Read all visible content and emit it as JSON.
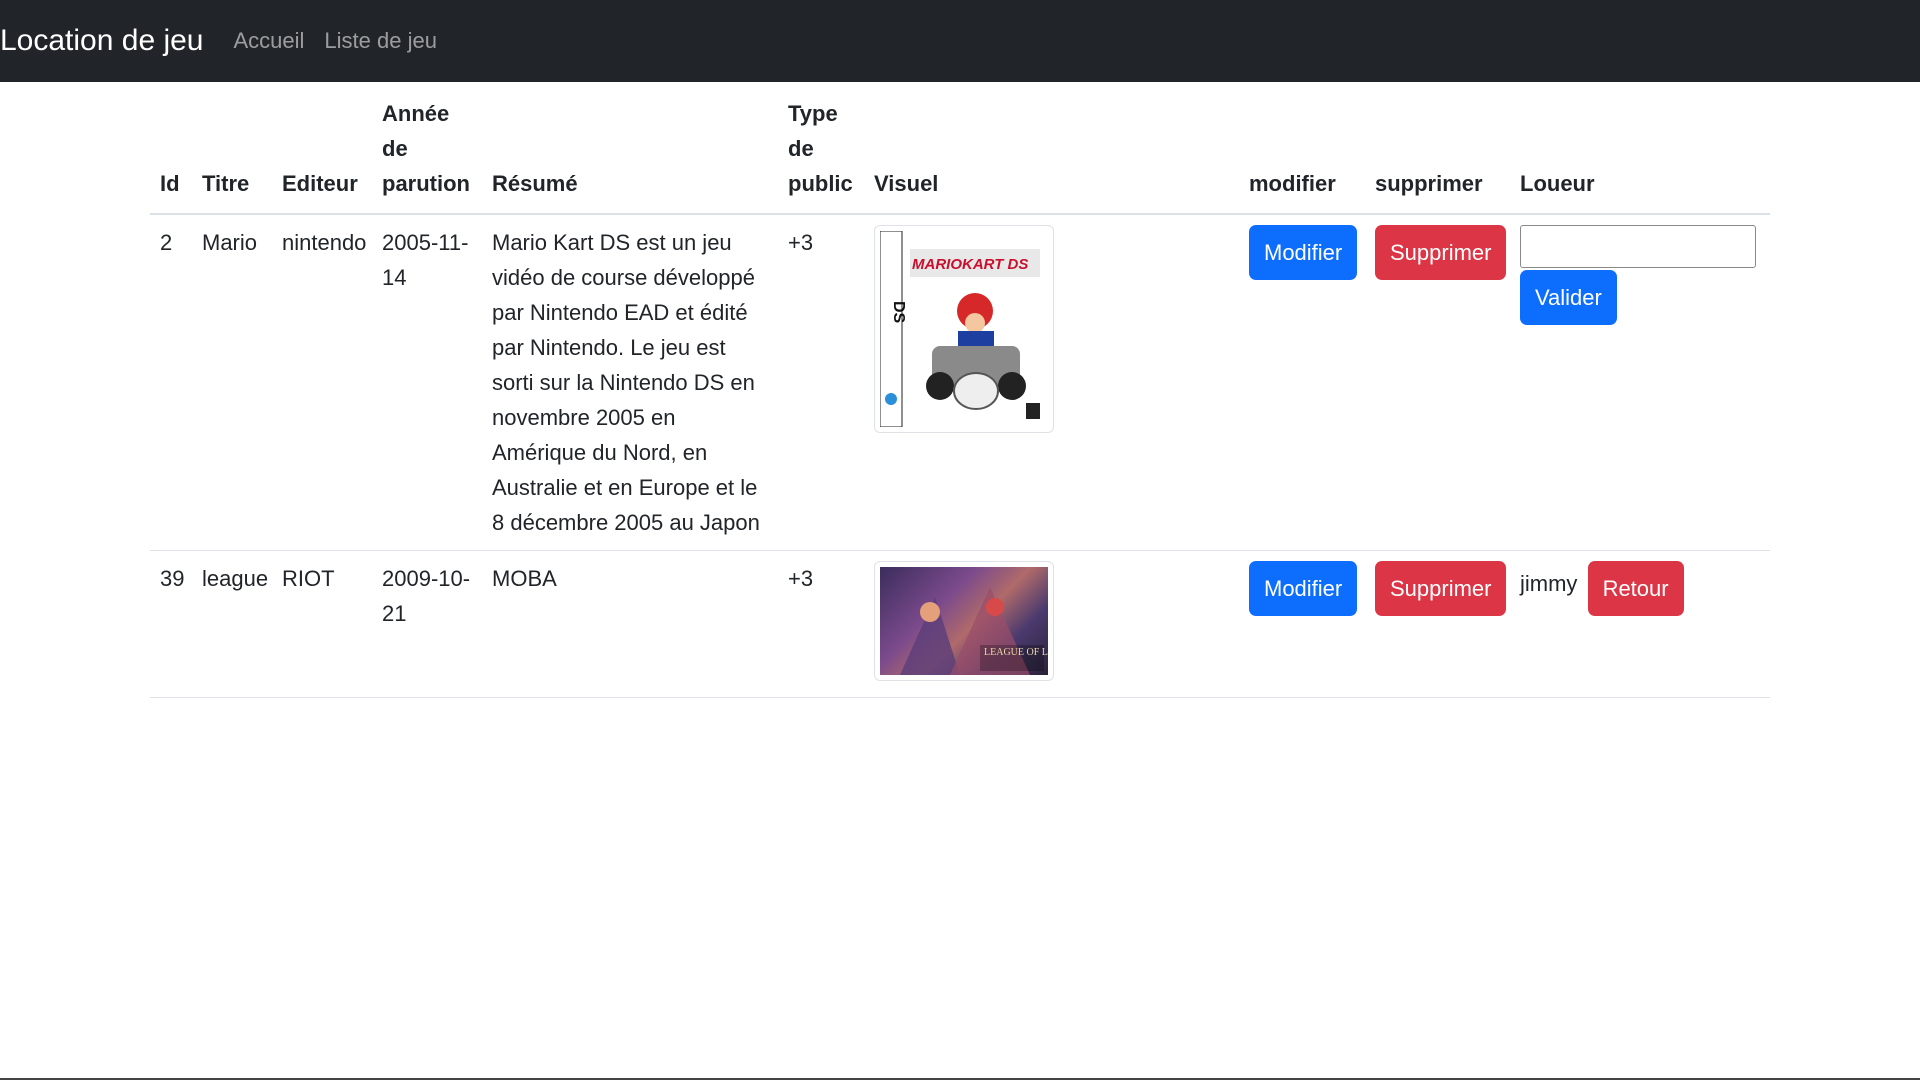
{
  "navbar": {
    "brand": "Location de jeu",
    "links": [
      "Accueil",
      "Liste de jeu"
    ]
  },
  "table": {
    "headers": {
      "id": "Id",
      "titre": "Titre",
      "editeur": "Editeur",
      "annee_line1": "Année de",
      "annee_line2": "parution",
      "resume": "Résumé",
      "type_line1": "Type",
      "type_line2": "de",
      "type_line3": "public",
      "visuel": "Visuel",
      "modifier": "modifier",
      "supprimer": "supprimer",
      "loueur": "Loueur"
    },
    "rows": [
      {
        "id": "2",
        "titre": "Mario",
        "editeur": "nintendo",
        "annee": "2005-11-14",
        "resume": "Mario Kart DS est un jeu vidéo de course développé par Nintendo EAD et édité par Nintendo. Le jeu est sorti sur la Nintendo DS en novembre 2005 en Amérique du Nord, en Australie et en Europe et le 8 décembre 2005 au Japon",
        "type": "+3",
        "visuel_icon": "mario-kart-ds-cover",
        "visuel_text": "MARIOKART DS",
        "modifier_label": "Modifier",
        "supprimer_label": "Supprimer",
        "loueur_value": "",
        "valider_label": "Valider"
      },
      {
        "id": "39",
        "titre": "league",
        "editeur": "RIOT",
        "annee": "2009-10-21",
        "resume": "MOBA",
        "type": "+3",
        "visuel_icon": "league-of-legends-cover",
        "visuel_text": "LEAGUE OF LEGENDS",
        "modifier_label": "Modifier",
        "supprimer_label": "Supprimer",
        "loueur_name": "jimmy",
        "retour_label": "Retour"
      }
    ]
  },
  "colors": {
    "navbar": "#212529",
    "primary": "#0d6efd",
    "danger": "#dc3545"
  }
}
